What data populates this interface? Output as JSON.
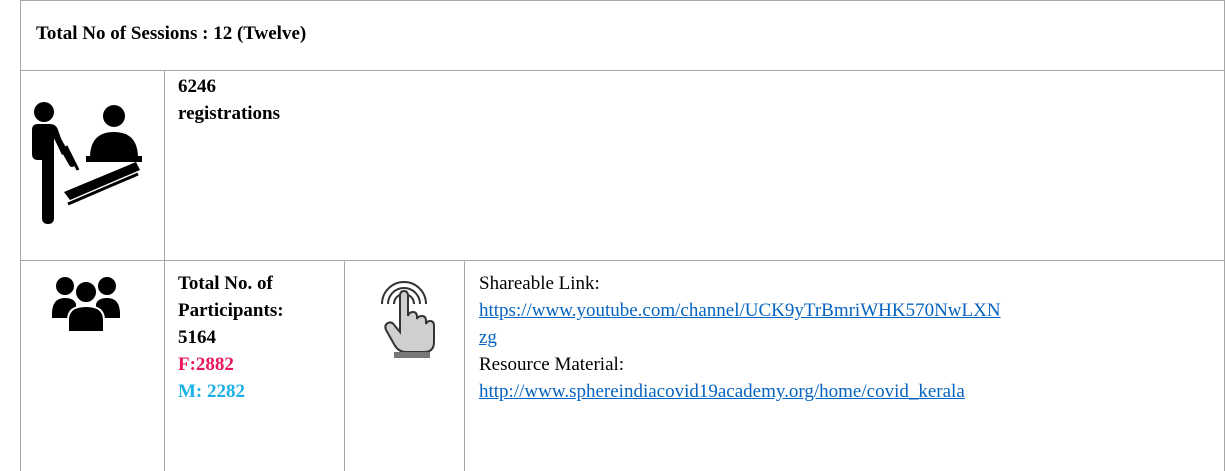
{
  "header": {
    "title": "Total No of Sessions : 12 (Twelve)"
  },
  "registrations": {
    "icon": "registration-desk-icon",
    "count": "6246",
    "label": "registrations"
  },
  "participants": {
    "icon": "people-group-icon",
    "heading_line1": "Total No. of",
    "heading_line2": "Participants:",
    "total": "5164",
    "female": "F:2882",
    "male": "M: 2282",
    "female_color": "#e8175d",
    "male_color": "#1ab0e8"
  },
  "links": {
    "icon": "touch-click-icon",
    "shareable_label": "Shareable Link:",
    "shareable_url_line1": "https://www.youtube.com/channel/UCK9yTrBmriWHK570NwLXN",
    "shareable_url_line2": "zg",
    "resource_label": "Resource Material:",
    "resource_url": "http://www.sphereindiacovid19academy.org/home/covid_kerala"
  }
}
